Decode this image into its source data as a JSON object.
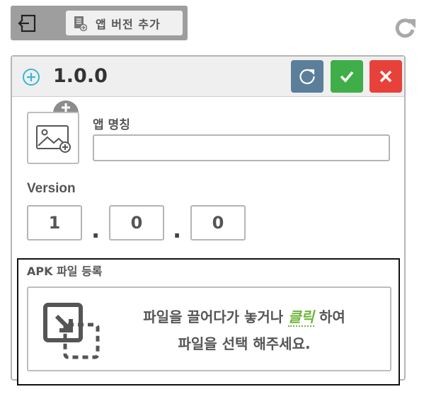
{
  "toolbar": {
    "add_version_label": "앱 버전 추가"
  },
  "card": {
    "version_title": "1.0.0"
  },
  "form": {
    "app_name_label": "앱 명칭",
    "app_name_value": "",
    "version_label": "Version",
    "version_major": "1",
    "version_minor": "0",
    "version_patch": "0",
    "version_separator": "."
  },
  "apk": {
    "label": "APK 파일 등록",
    "drop_text_before": "파일을 끌어다가 놓거나 ",
    "drop_click": "클릭",
    "drop_text_after": " 하여",
    "drop_text_line2": "파일을 선택 해주세요."
  },
  "colors": {
    "refresh_button": "#5b7f9b",
    "confirm_button": "#3fae49",
    "cancel_button": "#e8413a",
    "click_accent": "#6fb53b",
    "plus_icon": "#39b7d4"
  },
  "icons": {
    "back": "exit-back-icon",
    "document": "document-add-icon",
    "refresh": "refresh-icon",
    "plus": "plus-circle-icon",
    "check": "check-icon",
    "close": "close-icon",
    "image": "image-add-icon",
    "upload": "file-drop-icon"
  }
}
